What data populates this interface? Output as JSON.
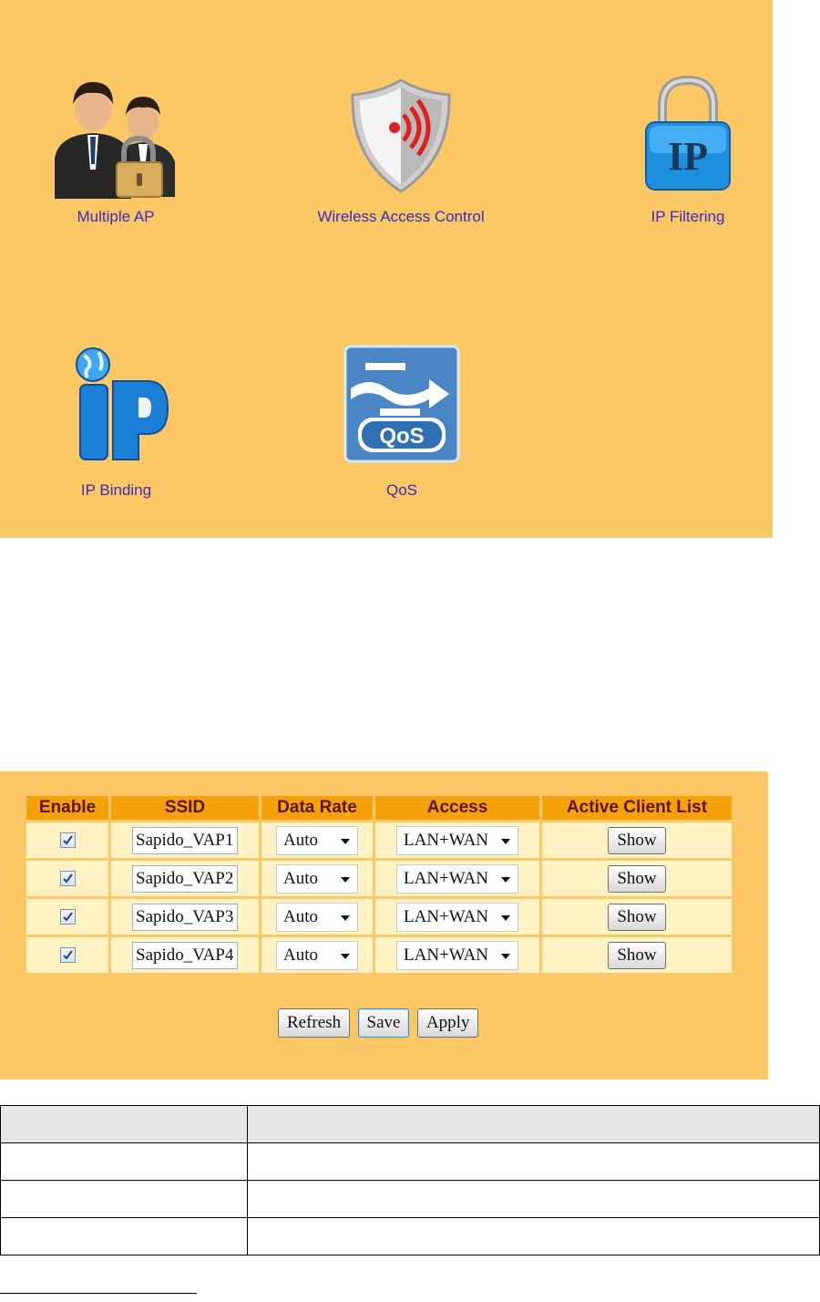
{
  "tiles": [
    {
      "label": "Multiple AP",
      "icon": "users-lock-icon"
    },
    {
      "label": "Wireless Access Control",
      "icon": "wireless-shield-icon"
    },
    {
      "label": "IP Filtering",
      "icon": "ip-padlock-icon"
    },
    {
      "label": "IP Binding",
      "icon": "ip-globe-icon"
    },
    {
      "label": "QoS",
      "icon": "qos-icon"
    }
  ],
  "qos_icon_text": "QoS",
  "ip_icon_text": "IP",
  "table": {
    "headers": [
      "Enable",
      "SSID",
      "Data Rate",
      "Access",
      "Active Client List"
    ],
    "rows": [
      {
        "enabled": true,
        "ssid": "Sapido_VAP1",
        "rate": "Auto",
        "access": "LAN+WAN",
        "action": "Show"
      },
      {
        "enabled": true,
        "ssid": "Sapido_VAP2",
        "rate": "Auto",
        "access": "LAN+WAN",
        "action": "Show"
      },
      {
        "enabled": true,
        "ssid": "Sapido_VAP3",
        "rate": "Auto",
        "access": "LAN+WAN",
        "action": "Show"
      },
      {
        "enabled": true,
        "ssid": "Sapido_VAP4",
        "rate": "Auto",
        "access": "LAN+WAN",
        "action": "Show"
      }
    ]
  },
  "buttons": {
    "refresh": "Refresh",
    "save": "Save",
    "apply": "Apply"
  },
  "colors": {
    "panel": "#fcc866",
    "header": "#f6a10c",
    "link": "#3a2bb8",
    "cell": "#fff3c4"
  }
}
